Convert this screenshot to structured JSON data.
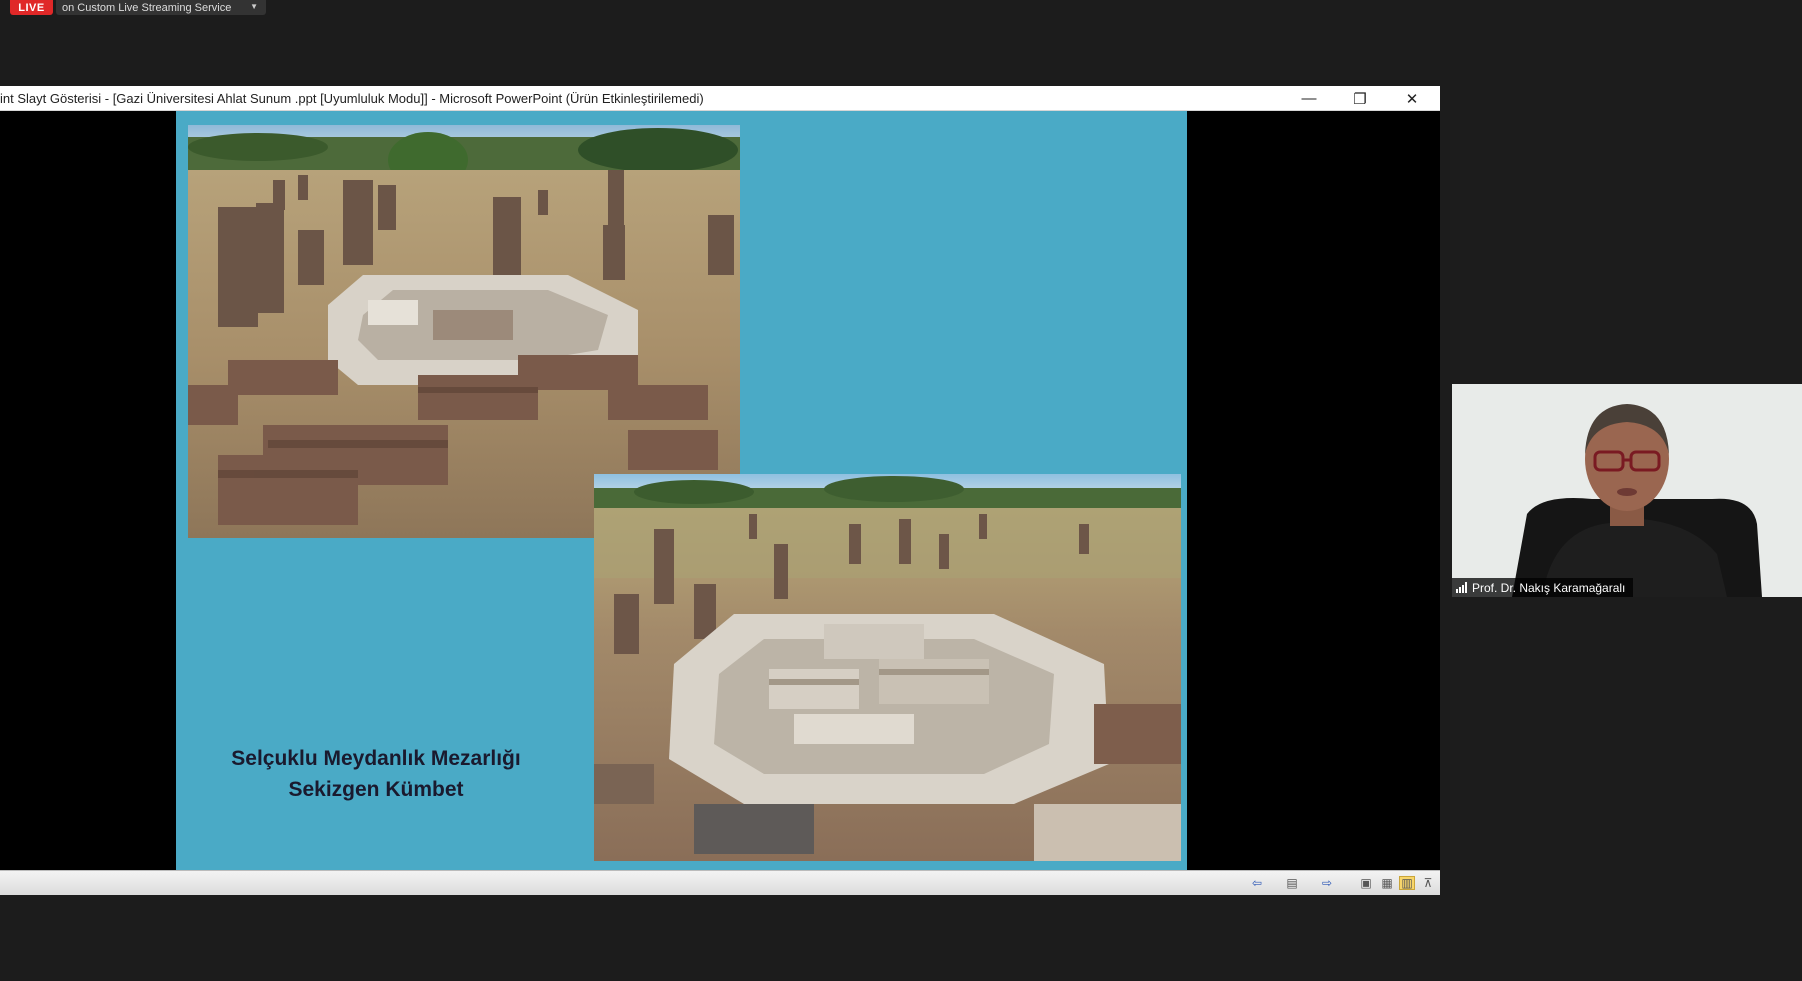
{
  "top_bar": {
    "live_label": "LIVE",
    "stream_label": "on Custom Live Streaming Service"
  },
  "window": {
    "title": "int Slayt Gösterisi - [Gazi Üniversitesi Ahlat Sunum .ppt [Uyumluluk Modu]] - Microsoft PowerPoint (Ürün Etkinleştirilemedi)",
    "minimize_glyph": "—",
    "restore_glyph": "❐",
    "close_glyph": "✕"
  },
  "slide": {
    "caption_line1": "Selçuklu Meydanlık Mezarlığı",
    "caption_line2": "Sekizgen Kümbet",
    "background_color": "#4aaac6"
  },
  "statusbar": {
    "prev_glyph": "⇦",
    "menu_glyph": "▤",
    "next_glyph": "⇨",
    "normal_glyph": "▣",
    "sorter_glyph": "▦",
    "reading_glyph": "▥",
    "slideshow_glyph": "⊼"
  },
  "participant": {
    "name": "Prof. Dr. Nakış Karamağaralı"
  }
}
